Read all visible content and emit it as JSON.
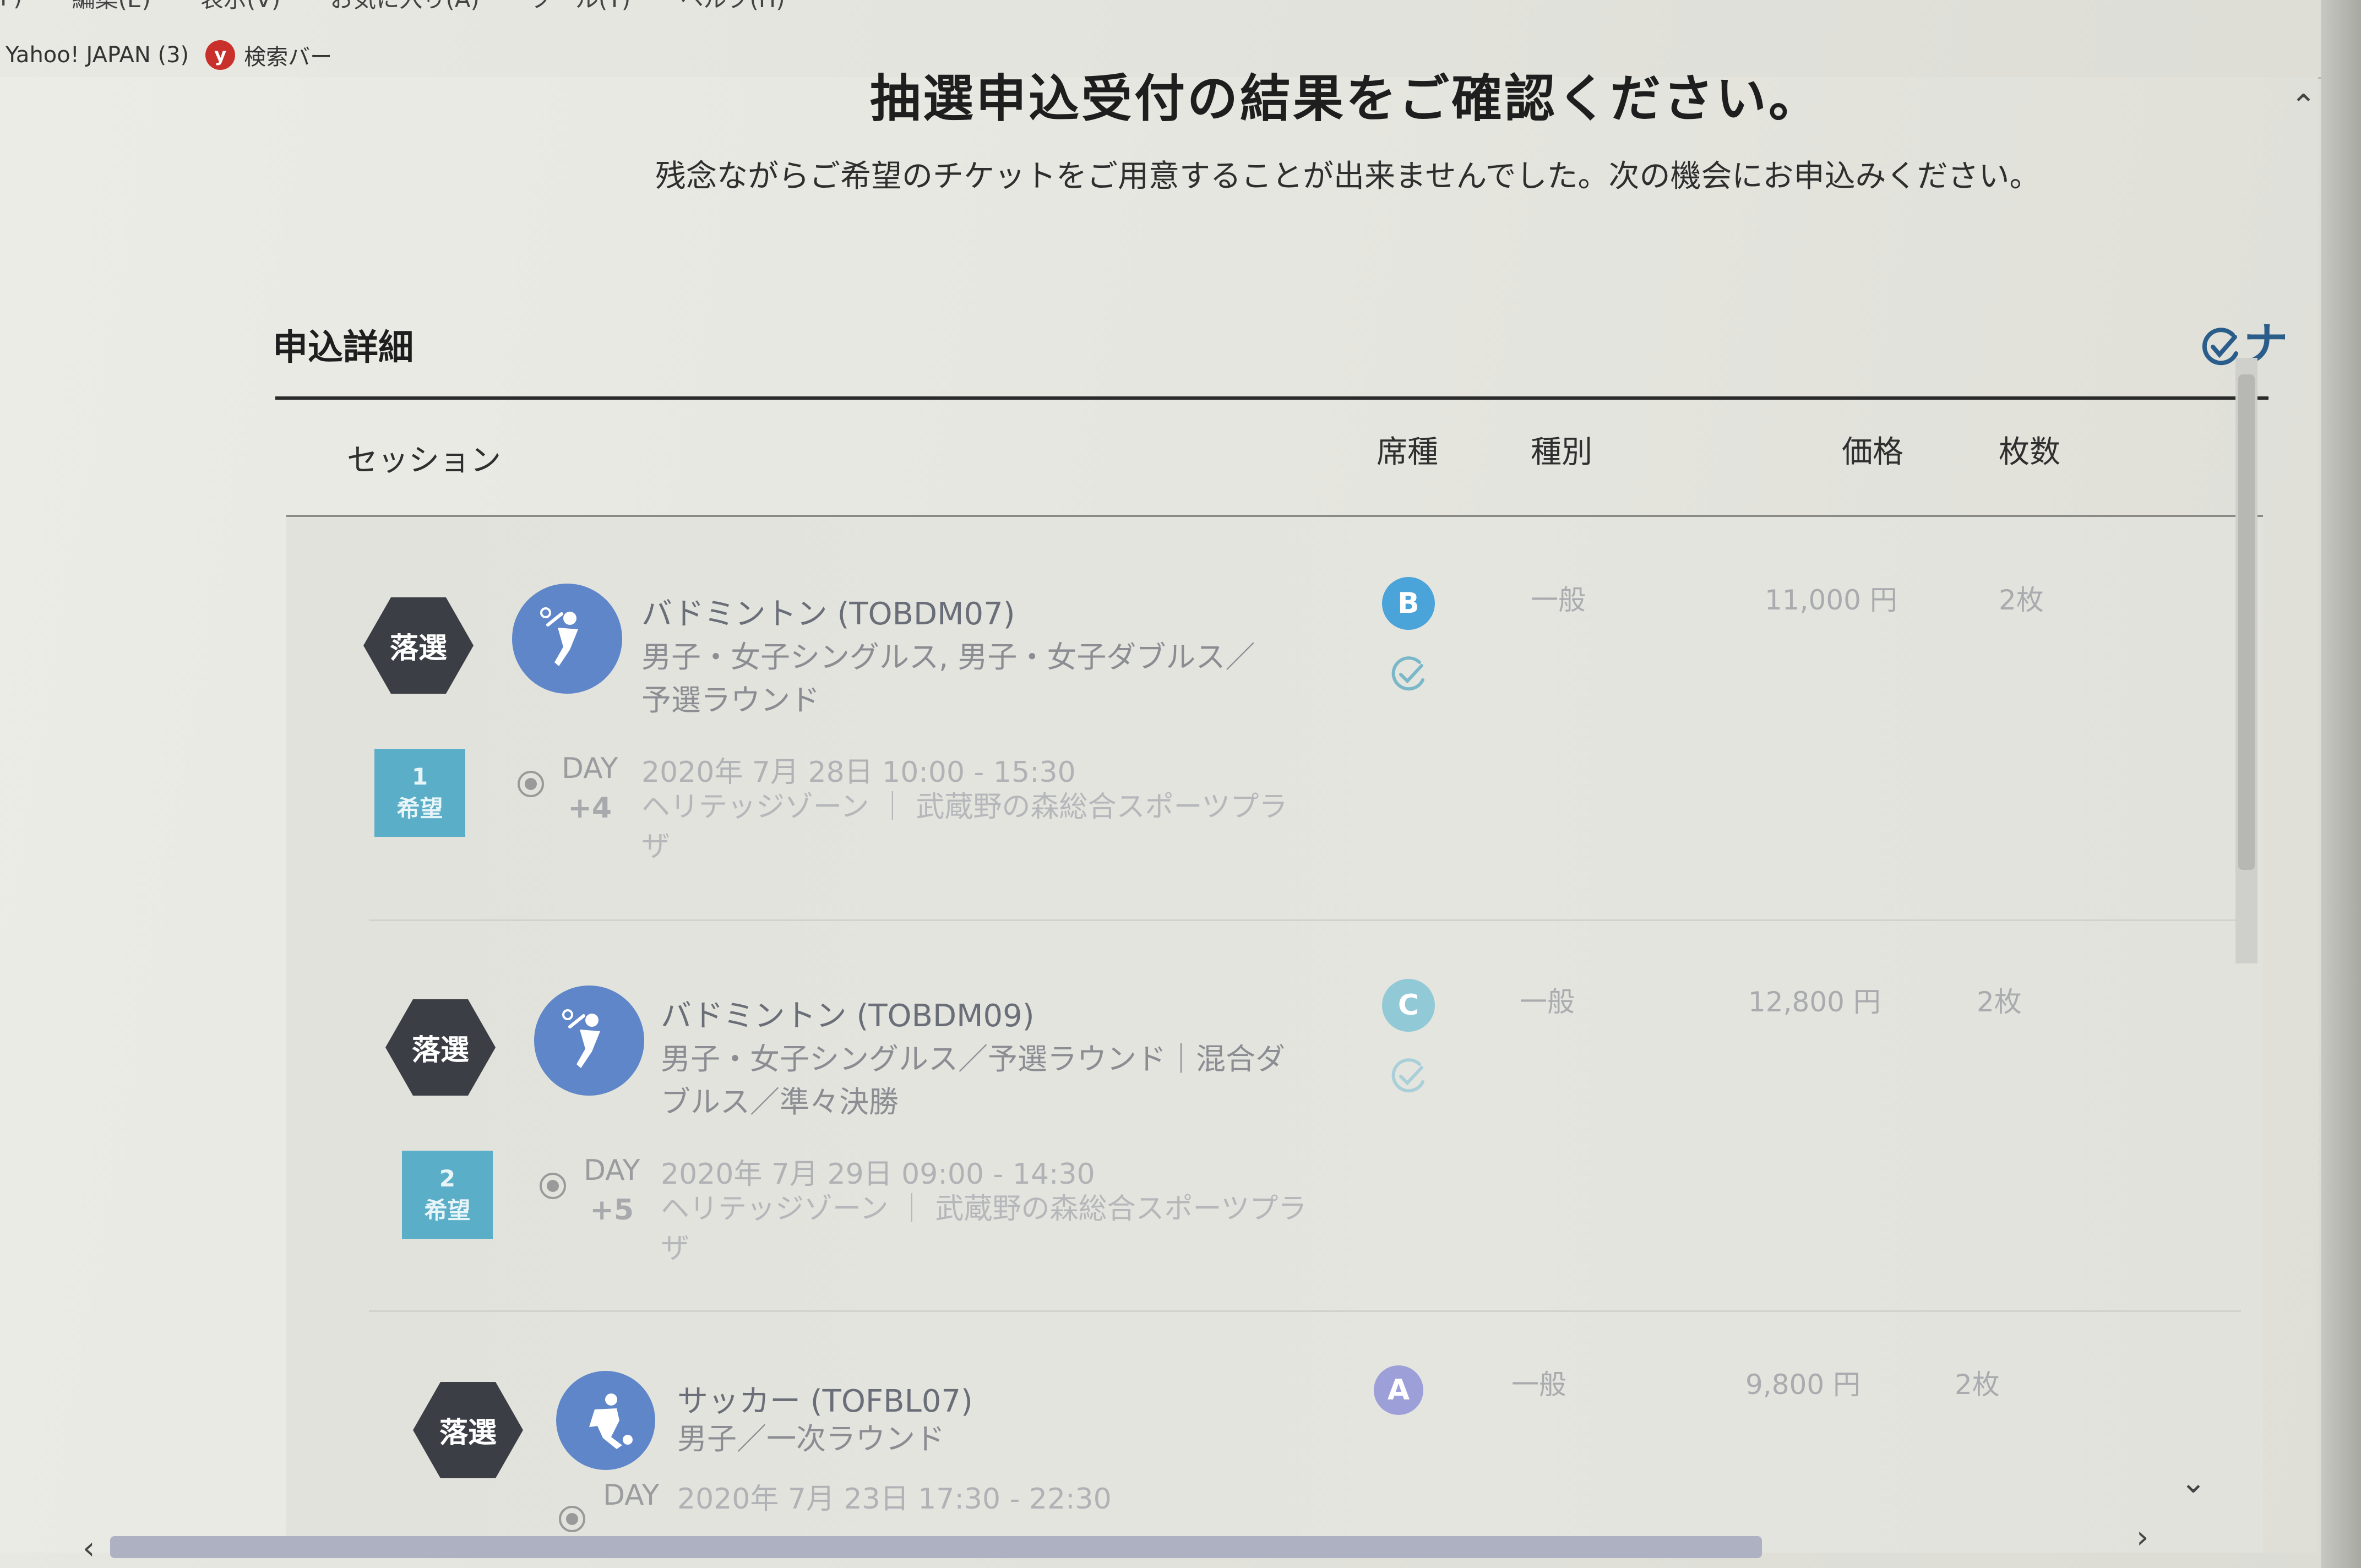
{
  "browser": {
    "menu": [
      "F)",
      "編集(E)",
      "表示(V)",
      "お気に入り(A)",
      "ツール(T)",
      "ヘルプ(H)"
    ],
    "favorites": [
      {
        "label": "Yahoo! JAPAN (3)"
      },
      {
        "icon": "y",
        "label": "検索バー"
      }
    ]
  },
  "page": {
    "heading": "抽選申込受付の結果をご確認ください。",
    "subtitle": "残念ながらご希望のチケットをご用意することが出来ませんでした。次の機会にお申込みください。",
    "section_title": "申込詳細",
    "corner_text": "ナ"
  },
  "table": {
    "headers": {
      "session": "セッション",
      "seat": "席種",
      "type": "種別",
      "price": "価格",
      "count": "枚数"
    },
    "rows": [
      {
        "status": "落選",
        "sport": "バドミントン (TOBDM07)",
        "description": "男子・女子シングルス, 男子・女子ダブルス／予選ラウンド",
        "preference_num": "1",
        "preference_label": "希望",
        "day": "DAY",
        "day_offset": "+4",
        "datetime": "2020年 7月 28日 10:00 - 15:30",
        "venue": "ヘリテッジゾーン ｜ 武蔵野の森総合スポーツプラザ",
        "seat": "B",
        "seat_color": "#4aa3d9",
        "ticket_type": "一般",
        "price": "11,000 円",
        "count": "2枚"
      },
      {
        "status": "落選",
        "sport": "バドミントン (TOBDM09)",
        "description": "男子・女子シングルス／予選ラウンド｜混合ダブルス／準々決勝",
        "preference_num": "2",
        "preference_label": "希望",
        "day": "DAY",
        "day_offset": "+5",
        "datetime": "2020年 7月 29日 09:00 - 14:30",
        "venue": "ヘリテッジゾーン ｜ 武蔵野の森総合スポーツプラザ",
        "seat": "C",
        "seat_color": "#92c9d6",
        "ticket_type": "一般",
        "price": "12,800 円",
        "count": "2枚"
      },
      {
        "status": "落選",
        "sport": "サッカー (TOFBL07)",
        "description": "男子／一次ラウンド",
        "day": "DAY",
        "datetime": "2020年 7月 23日 17:30 - 22:30",
        "seat": "A",
        "seat_color": "#9c9fd8",
        "ticket_type": "一般",
        "price": "9,800 円",
        "count": "2枚"
      }
    ]
  },
  "colors": {
    "lost_badge": "#3b3f45",
    "sport_icon": "#5e86c8",
    "preference_badge": "#5aaec7"
  }
}
